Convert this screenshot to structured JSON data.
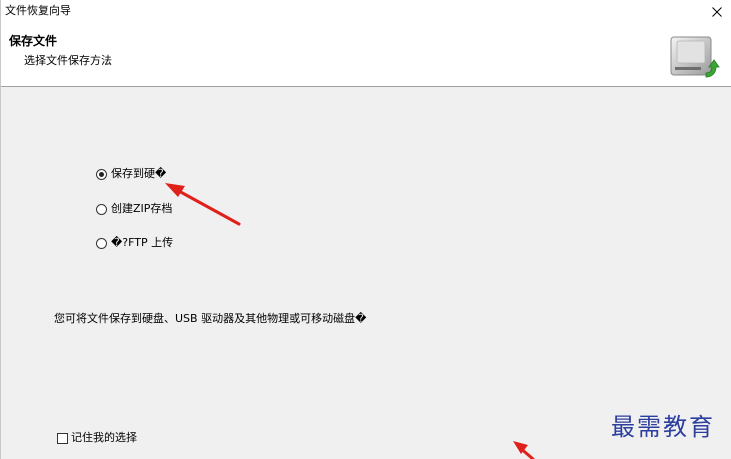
{
  "window": {
    "title": "文件恢复向导"
  },
  "header": {
    "title": "保存文件",
    "subtitle": "选择文件保存方法"
  },
  "options": [
    {
      "label": "保存到硬�",
      "selected": true
    },
    {
      "label": "创建ZIP存档",
      "selected": false
    },
    {
      "label": "�?FTP 上传",
      "selected": false
    }
  ],
  "description": "您可将文件保存到硬盘、USB 驱动器及其他物理或可移动磁盘�",
  "remember_choice": {
    "label": "记住我的选择",
    "checked": false
  },
  "watermark": "最需教育",
  "colors": {
    "annotation_arrow": "#e0201a",
    "watermark": "#2c3e9e",
    "drive_arrow": "#3aa635"
  },
  "icons": {
    "close": "close-icon",
    "drive": "hard-drive-save-icon"
  }
}
